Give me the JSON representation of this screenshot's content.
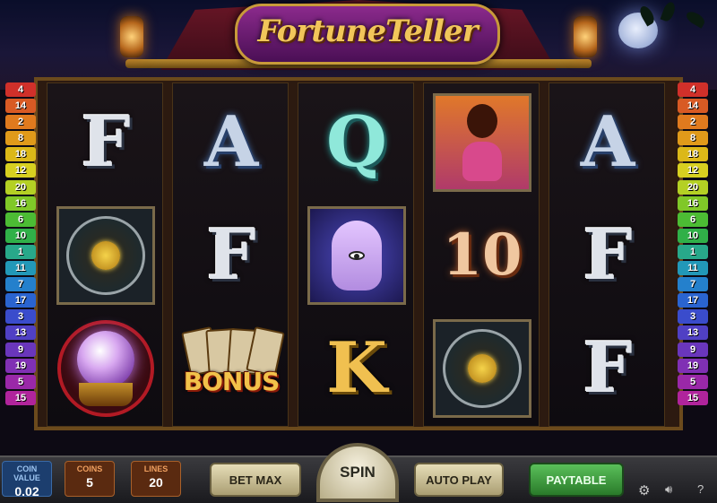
{
  "game": {
    "title": "FortuneTeller"
  },
  "paylines_left": [
    "4",
    "14",
    "2",
    "8",
    "18",
    "12",
    "20",
    "16",
    "6",
    "10",
    "1",
    "11",
    "7",
    "17",
    "3",
    "13",
    "9",
    "19",
    "5",
    "15"
  ],
  "paylines_right": [
    "4",
    "14",
    "2",
    "8",
    "18",
    "12",
    "20",
    "16",
    "6",
    "10",
    "1",
    "11",
    "7",
    "17",
    "3",
    "13",
    "9",
    "19",
    "5",
    "15"
  ],
  "payline_colors": [
    "#d0302a",
    "#d85a24",
    "#e07a1e",
    "#e09a1a",
    "#dcb818",
    "#d8d020",
    "#b4d024",
    "#80c828",
    "#4cbc34",
    "#30b048",
    "#28a88a",
    "#2298b8",
    "#2480cc",
    "#2a64d0",
    "#3a4ccc",
    "#5040c4",
    "#6a36bc",
    "#8030b4",
    "#9a28a8",
    "#b0249c"
  ],
  "reels": [
    [
      "F",
      "zodiac",
      "crystal-ball"
    ],
    [
      "A",
      "F",
      "bonus"
    ],
    [
      "Q",
      "palm",
      "K"
    ],
    [
      "dancer",
      "10",
      "zodiac"
    ],
    [
      "A",
      "F",
      "F"
    ]
  ],
  "bonus_label": "BONUS",
  "controls": {
    "coin_value_label": "COIN VALUE",
    "coin_value": "0.02",
    "coins_label": "COINS",
    "coins": "5",
    "lines_label": "LINES",
    "lines": "20",
    "bet_max": "BET MAX",
    "spin": "SPIN",
    "auto_play": "AUTO PLAY",
    "paytable": "PAYTABLE"
  },
  "utility": {
    "settings_icon": "gear-icon",
    "sound_icon": "speaker-icon",
    "help": "?"
  }
}
